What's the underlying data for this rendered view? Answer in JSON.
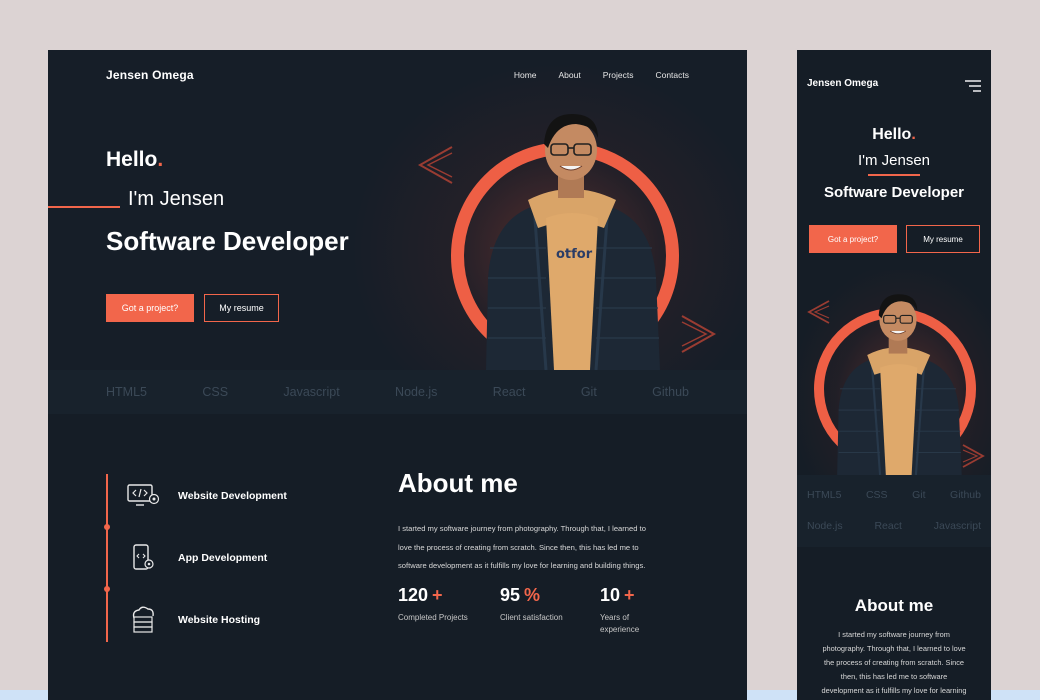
{
  "brand": "Jensen Omega",
  "nav": [
    "Home",
    "About",
    "Projects",
    "Contacts"
  ],
  "hero": {
    "hello": "Hello",
    "dot": ".",
    "im": "I'm Jensen",
    "role": "Software Developer",
    "btn_primary": "Got a project?",
    "btn_secondary": "My resume"
  },
  "skills_desktop": [
    "HTML5",
    "CSS",
    "Javascript",
    "Node.js",
    "React",
    "Git",
    "Github"
  ],
  "skills_mobile_row1": [
    "HTML5",
    "CSS",
    "Git",
    "Github"
  ],
  "skills_mobile_row2": [
    "Node.js",
    "React",
    "Javascript"
  ],
  "services": [
    {
      "label": "Website Development",
      "icon": "code-monitor-icon"
    },
    {
      "label": "App Development",
      "icon": "mobile-code-icon"
    },
    {
      "label": "Website Hosting",
      "icon": "cloud-server-icon"
    }
  ],
  "about": {
    "title": "About me",
    "text_lines": [
      "I started my software journey from photography. Through that, I learned to",
      "love the process of creating from scratch. Since then, this has led me to",
      "software development as it fulfills my love for learning and building things."
    ],
    "mobile_lines": [
      "I started my software journey from",
      "photography. Through that, I learned to love",
      "the process of creating from scratch. Since",
      "then, this has led me to software",
      "development as it fulfills my love for learning"
    ]
  },
  "stats": [
    {
      "num": "120",
      "suffix": "+",
      "label": "Completed Projects"
    },
    {
      "num": "95",
      "suffix": "%",
      "label": "Client satisfaction"
    },
    {
      "num": "10",
      "suffix": "+",
      "label": "Years of experience"
    }
  ],
  "colors": {
    "accent": "#f2664b",
    "bg": "#151d26",
    "page": "#dcd3d3"
  }
}
